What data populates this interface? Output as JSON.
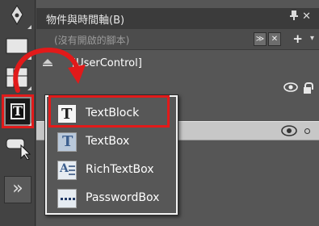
{
  "panel": {
    "title": "物件與時間軸(B)",
    "pin_glyph": "▼",
    "close_glyph": "✕"
  },
  "storyboard": {
    "placeholder": "(沒有開啟的腳本)",
    "menu_btn_glyph": "≫",
    "close_btn_glyph": "✕",
    "add_glyph": "+",
    "dropdown_glyph": "▾"
  },
  "tree": {
    "usercontrol_label": "[UserControl]"
  },
  "toolbar": {
    "text_tool_glyph": "T",
    "expand_glyph": "»"
  },
  "flyout": {
    "items": [
      {
        "label": "TextBlock",
        "icon": "textblock-icon",
        "glyph": "T"
      },
      {
        "label": "TextBox",
        "icon": "textbox-icon",
        "glyph": "T"
      },
      {
        "label": "RichTextBox",
        "icon": "richtextbox-icon",
        "glyph": "A"
      },
      {
        "label": "PasswordBox",
        "icon": "passwordbox-icon"
      }
    ]
  },
  "colors": {
    "highlight": "#e11a1a",
    "panel_bg": "#565656",
    "selection": "#c7c7c7"
  }
}
